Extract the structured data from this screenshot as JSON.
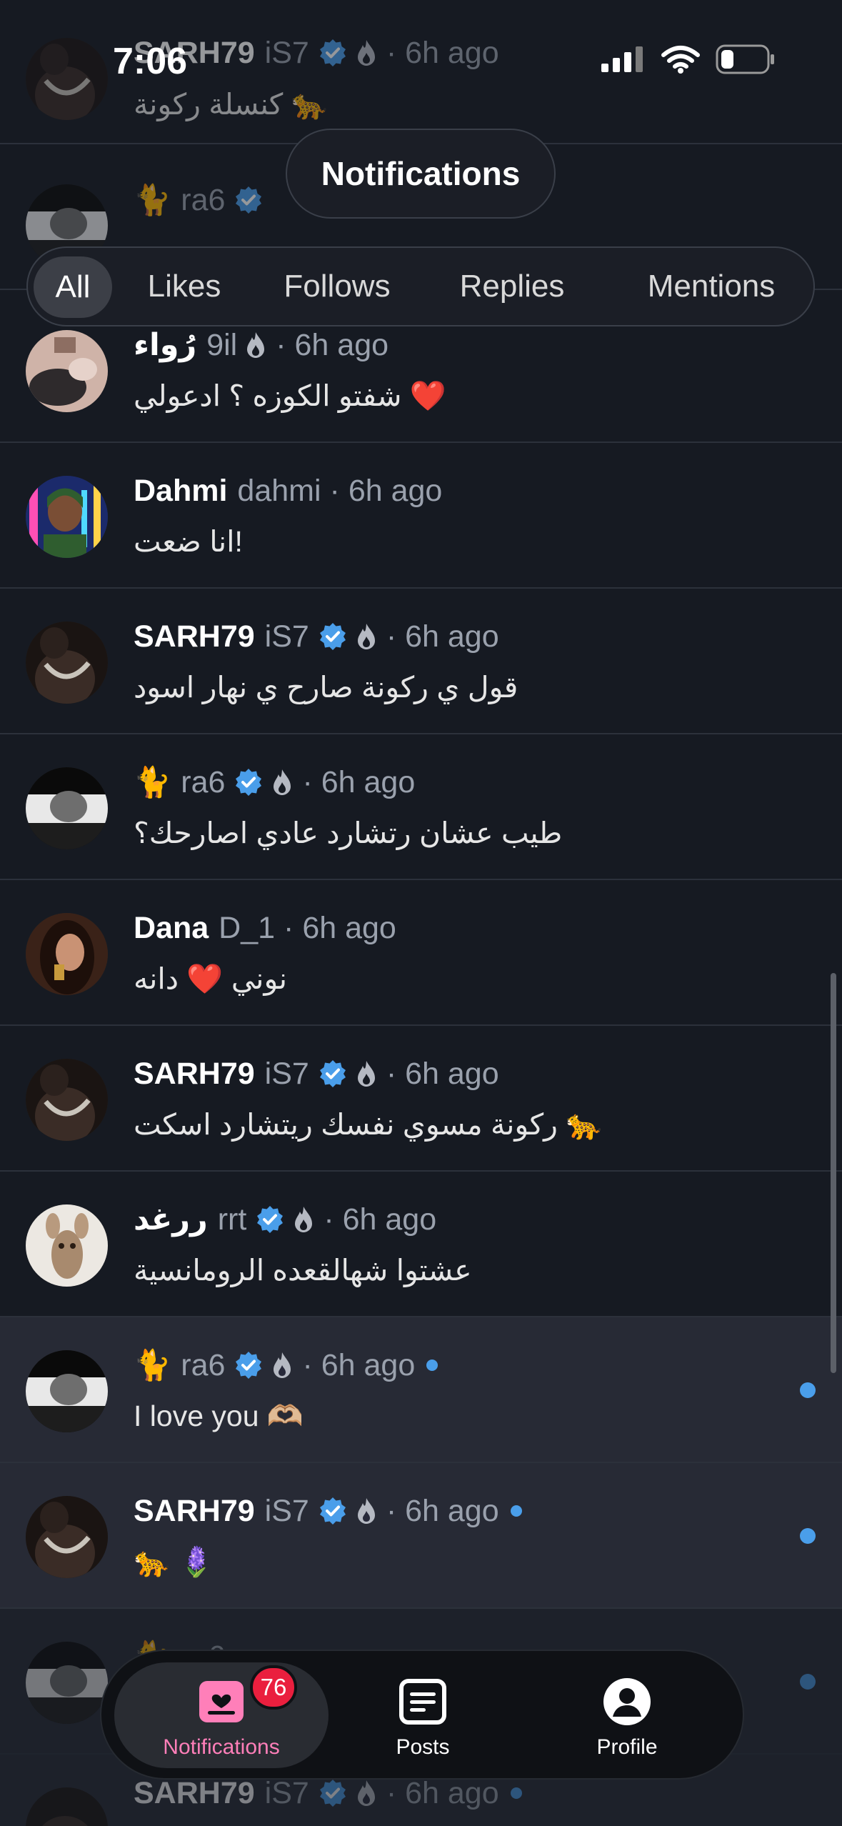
{
  "status_bar": {
    "time": "7:06",
    "battery_level": 0.25
  },
  "header": {
    "title": "Notifications"
  },
  "filter_tabs": [
    {
      "label": "All",
      "active": true
    },
    {
      "label": "Likes"
    },
    {
      "label": "Follows"
    },
    {
      "label": "Replies"
    },
    {
      "label": "Mentions"
    }
  ],
  "notifications": [
    {
      "prefix": "",
      "name": "SARH79",
      "handle": "iS7",
      "time": "· 6h ago",
      "message": "كنسلة ركونة 🐆"
    },
    {
      "prefix": "🐈",
      "name": "",
      "handle": "ra6",
      "time": "· 6h ago",
      "message": ""
    },
    {
      "prefix": "",
      "name": "رُواء",
      "handle": "9il",
      "time": "· 6h ago",
      "message": "شفتو الكوزه ؟ ادعولي ❤️"
    },
    {
      "prefix": "",
      "name": "Dahmi",
      "handle": "dahmi",
      "time": "· 6h ago",
      "message": "انا ضعت!"
    },
    {
      "prefix": "",
      "name": "SARH79",
      "handle": "iS7",
      "time": "· 6h ago",
      "message": "قول ي ركونة صارح ي نهار اسود"
    },
    {
      "prefix": "🐈",
      "name": "",
      "handle": "ra6",
      "time": "· 6h ago",
      "message": "طيب عشان رتشارد عادي اصارحك؟"
    },
    {
      "prefix": "",
      "name": "Dana",
      "handle": "D_1",
      "time": "· 6h ago",
      "message": "نوني ❤️ دانه"
    },
    {
      "prefix": "",
      "name": "SARH79",
      "handle": "iS7",
      "time": "· 6h ago",
      "message": "ركونة مسوي نفسك ريتشارد اسكت 🐆"
    },
    {
      "prefix": "",
      "name": "ررغد",
      "handle": "rrt",
      "time": "· 6h ago",
      "message": "عشتوا شهالقعده الرومانسية"
    },
    {
      "prefix": "🐈",
      "name": "",
      "handle": "ra6",
      "time": "· 6h ago",
      "message": "I love you 🫶🏼"
    },
    {
      "prefix": "",
      "name": "SARH79",
      "handle": "iS7",
      "time": "· 6h ago",
      "message": "🐆 🪻"
    },
    {
      "prefix": "🐈",
      "name": "",
      "handle": "ra6",
      "time": "· 6h ago",
      "message": ""
    },
    {
      "prefix": "",
      "name": "SARH79",
      "handle": "iS7",
      "time": "· 6h ago",
      "message": ""
    }
  ],
  "bottom_tabs": {
    "notifications": {
      "label": "Notifications",
      "badge": "76"
    },
    "posts": {
      "label": "Posts"
    },
    "profile": {
      "label": "Profile"
    }
  },
  "colors": {
    "background": "#161a22",
    "unread_background": "#272a35",
    "accent_blue": "#4a9eea",
    "active_tab_pink": "#ff7fb9",
    "badge_red": "#ea1f3e"
  }
}
